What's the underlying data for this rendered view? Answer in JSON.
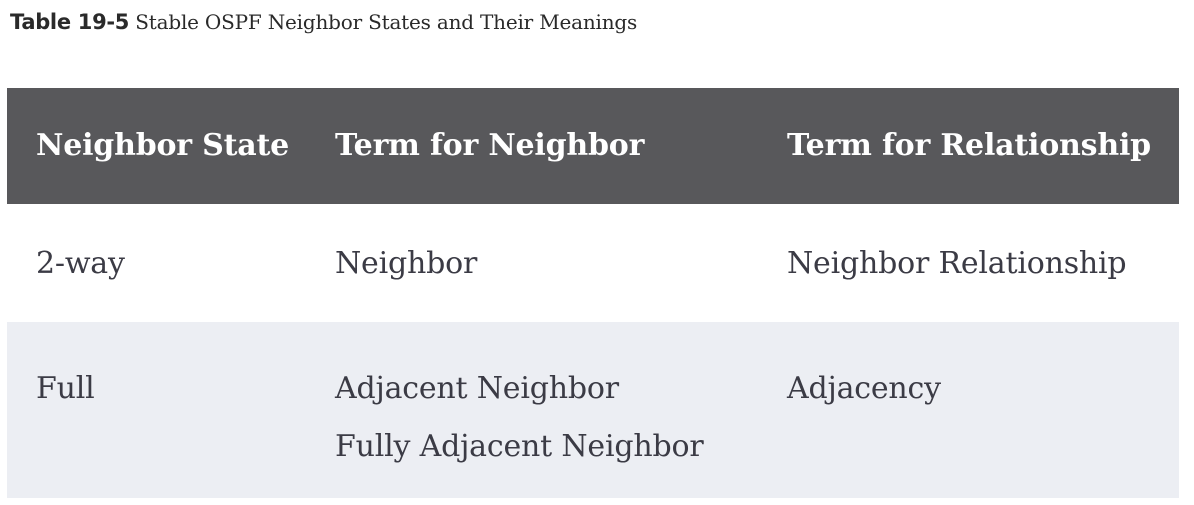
{
  "caption": {
    "label": "Table 19-5",
    "text": " Stable OSPF Neighbor States and Their Meanings"
  },
  "table": {
    "headers": [
      "Neighbor State",
      "Term for Neighbor",
      "Term for Relationship"
    ],
    "rows": [
      {
        "state": "2-way",
        "neighbor_terms": [
          "Neighbor"
        ],
        "relationship": "Neighbor Relationship"
      },
      {
        "state": "Full",
        "neighbor_terms": [
          "Adjacent Neighbor",
          "Fully Adjacent Neighbor"
        ],
        "relationship": "Adjacency"
      }
    ]
  },
  "colors": {
    "header_bg": "#58585b",
    "header_text": "#ffffff",
    "row_alt_bg": "#eceef3",
    "body_text": "#3b3b45"
  }
}
